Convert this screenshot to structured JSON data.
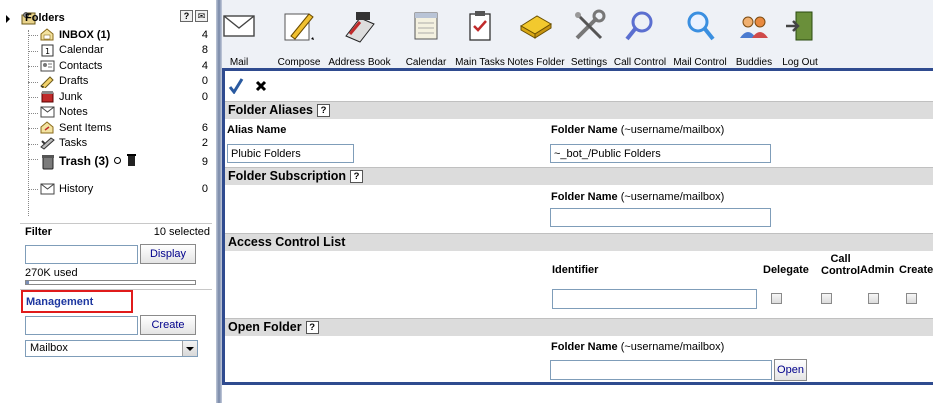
{
  "sidebar": {
    "root_label": "Folders",
    "help_icon": "question-icon",
    "folders": [
      {
        "name": "INBOX (1)",
        "count": "4",
        "icon": "inbox-icon",
        "bold": true
      },
      {
        "name": "Calendar",
        "count": "8",
        "icon": "calendar-icon"
      },
      {
        "name": "Contacts",
        "count": "4",
        "icon": "contacts-icon"
      },
      {
        "name": "Drafts",
        "count": "0",
        "icon": "drafts-icon"
      },
      {
        "name": "Junk",
        "count": "0",
        "icon": "junk-icon"
      },
      {
        "name": "Notes",
        "count": "",
        "icon": "notes-icon"
      },
      {
        "name": "Sent Items",
        "count": "6",
        "icon": "sent-icon"
      },
      {
        "name": "Tasks",
        "count": "2",
        "icon": "tasks-icon"
      },
      {
        "name": "Trash (3)",
        "count": "9",
        "icon": "trash-icon",
        "bold": true
      },
      {
        "name": "History",
        "count": "0",
        "icon": "history-icon"
      }
    ],
    "filter": {
      "title": "Filter",
      "selected": "10 selected",
      "value": "",
      "button": "Display"
    },
    "quota": {
      "text": "270K used",
      "fraction": 0.02
    },
    "management": {
      "title": "Management",
      "value": "",
      "button": "Create",
      "select_value": "Mailbox"
    }
  },
  "toolbar": {
    "items": [
      {
        "label": "Mail",
        "icon": "mail-icon"
      },
      {
        "label": "Compose",
        "icon": "compose-icon"
      },
      {
        "label": "Address Book",
        "icon": "address-book-icon"
      },
      {
        "label": "Calendar",
        "icon": "calendar-icon"
      },
      {
        "label": "Main Tasks",
        "icon": "tasks-icon"
      },
      {
        "label": "Notes Folder",
        "icon": "notes-icon"
      },
      {
        "label": "Settings",
        "icon": "settings-icon"
      },
      {
        "label": "Call Control",
        "icon": "call-control-icon"
      },
      {
        "label": "Mail Control",
        "icon": "mail-control-icon"
      },
      {
        "label": "Buddies",
        "icon": "buddies-icon"
      },
      {
        "label": "Log Out",
        "icon": "logout-icon"
      }
    ]
  },
  "main": {
    "actions": {
      "save_icon": "checkmark-icon",
      "cancel_icon": "close-icon"
    },
    "aliases": {
      "title": "Folder Aliases",
      "alias_label": "Alias Name",
      "folder_label": "Folder Name",
      "folder_hint": "(~username/mailbox)",
      "alias_value": "Plubic Folders",
      "folder_value": "~_bot_/Public Folders"
    },
    "subscription": {
      "title": "Folder Subscription",
      "folder_label": "Folder Name",
      "folder_hint": "(~username/mailbox)",
      "value": ""
    },
    "acl": {
      "title": "Access Control List",
      "identifier_label": "Identifier",
      "delegate": "Delegate",
      "call": "Call",
      "control": "Control",
      "admin": "Admin",
      "create": "Create",
      "value": ""
    },
    "open": {
      "title": "Open Folder",
      "folder_label": "Folder Name",
      "folder_hint": "(~username/mailbox)",
      "value": "",
      "button": "Open"
    }
  },
  "colors": {
    "accent": "#2f4b8f",
    "highlight_border": "#e01b1b",
    "link": "#1d37a0",
    "section_bg": "#dcdcdc"
  }
}
